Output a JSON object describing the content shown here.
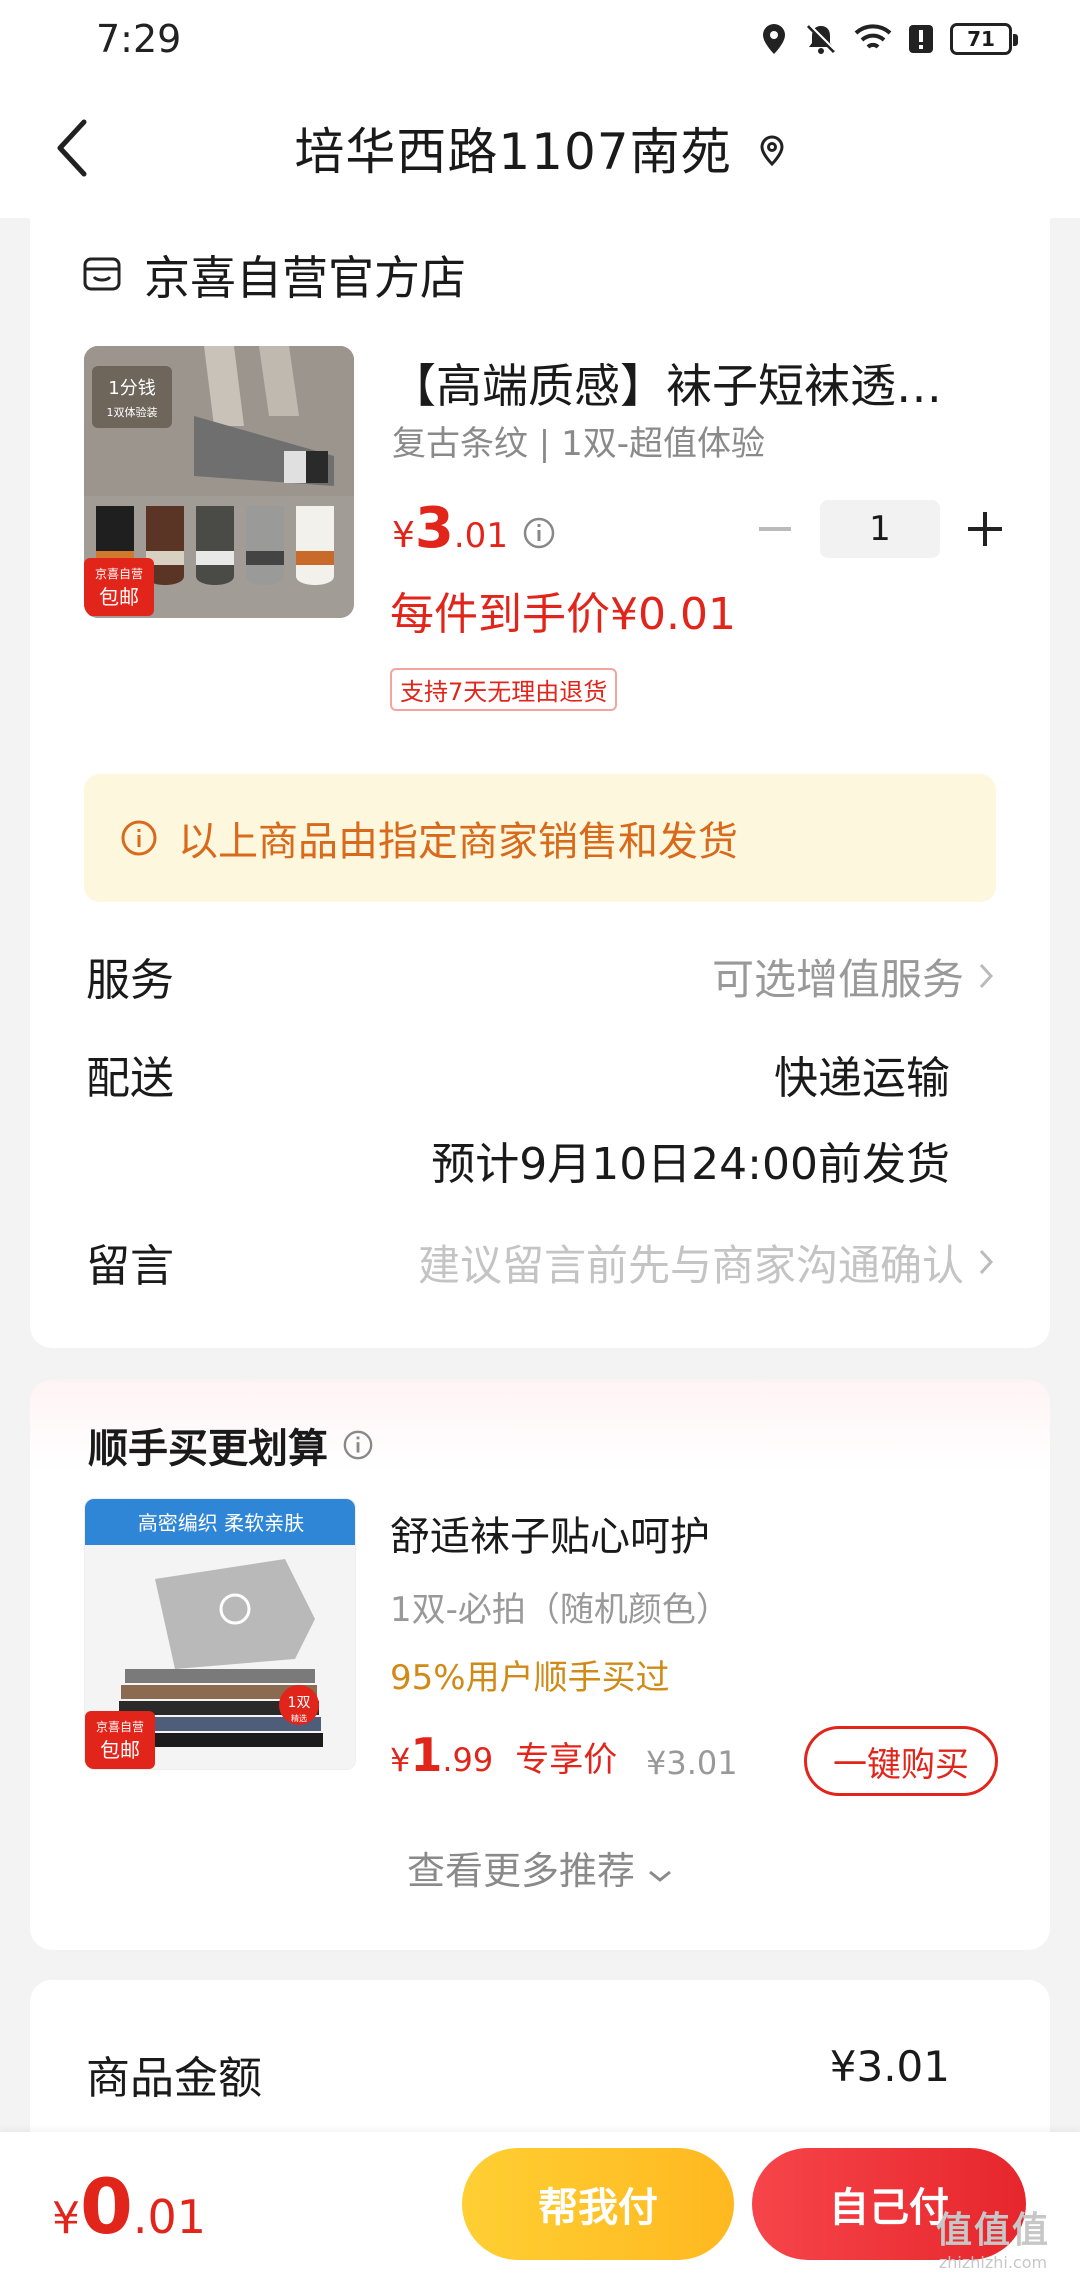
{
  "status_bar": {
    "time": "7:29",
    "battery": "71"
  },
  "nav": {
    "title": "培华西路1107南苑"
  },
  "store": {
    "name": "京喜自营官方店"
  },
  "product": {
    "title": "【高端质感】袜子短袜透…",
    "spec": "复古条纹 | 1双-超值体验",
    "price_yen": "¥",
    "price_int": "3",
    "price_dec": ".01",
    "quantity": "1",
    "unit_price": "每件到手价¥0.01",
    "return_tag": "支持7天无理由退货",
    "image_text": {
      "top_badge_1": "1分钱",
      "top_badge_2": "1双体验装",
      "corner_1": "京喜自营",
      "corner_2": "包邮"
    }
  },
  "notice": {
    "text": "以上商品由指定商家销售和发货"
  },
  "service": {
    "label": "服务",
    "value": "可选增值服务"
  },
  "delivery": {
    "label": "配送",
    "method": "快递运输",
    "eta": "预计9月10日24:00前发货"
  },
  "message": {
    "label": "留言",
    "placeholder": "建议留言前先与商家沟通确认"
  },
  "reco": {
    "section_title": "顺手买更划算",
    "name": "舒适袜子贴心呵护",
    "spec": "1双-必拍（随机颜色）",
    "rate": "95%用户顺手买过",
    "price_yen": "¥",
    "price_int": "1",
    "price_dec": ".99",
    "price_label": "专享价",
    "original_price": "¥3.01",
    "buy_label": "一键购买",
    "more_label": "查看更多推荐",
    "image_text": {
      "banner": "高密编织 柔软亲肤",
      "corner_1": "京喜自营",
      "corner_2": "包邮",
      "tag_1": "1双",
      "tag_2": "精选"
    }
  },
  "summary": {
    "label": "商品金额",
    "value": "¥3.01"
  },
  "bottom": {
    "total_yen": "¥",
    "total_int": "0",
    "total_dec": ".01",
    "help_pay": "帮我付",
    "self_pay": "自己付"
  },
  "watermark": {
    "logo": "值值值",
    "url": "zhizhizhi.com"
  },
  "colors": {
    "accent_red": "#e1251b",
    "notice_bg": "#fdf7dd",
    "notice_text": "#d9691b",
    "help_pay_bg": "#ffc12b",
    "self_pay_bg": "#ec2f35"
  }
}
